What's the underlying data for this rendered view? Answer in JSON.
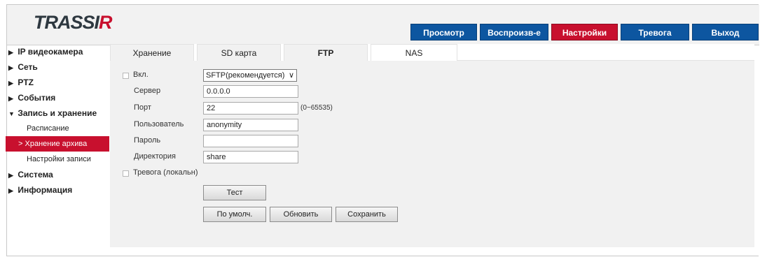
{
  "brand": {
    "logo_main": "TRASSI",
    "logo_accent": "R"
  },
  "topnav": [
    {
      "label": "Просмотр",
      "active": false
    },
    {
      "label": "Воспроизв-е",
      "active": false
    },
    {
      "label": "Настройки",
      "active": true
    },
    {
      "label": "Тревога",
      "active": false
    },
    {
      "label": "Выход",
      "active": false
    }
  ],
  "sidebar": {
    "items": [
      {
        "label": "IP видеокамера",
        "arrow": "▶"
      },
      {
        "label": "Сеть",
        "arrow": "▶"
      },
      {
        "label": "PTZ",
        "arrow": "▶"
      },
      {
        "label": "События",
        "arrow": "▶"
      },
      {
        "label": "Запись и хранение",
        "arrow": "▼"
      },
      {
        "label": "Система",
        "arrow": "▶"
      },
      {
        "label": "Информация",
        "arrow": "▶"
      }
    ],
    "sub": [
      {
        "label": "Расписание"
      },
      {
        "label": "Хранение архива",
        "prefix": ">"
      },
      {
        "label": "Настройки записи"
      }
    ]
  },
  "tabs": [
    {
      "label": "Хранение"
    },
    {
      "label": "SD карта"
    },
    {
      "label": "FTP"
    },
    {
      "label": "NAS"
    }
  ],
  "form": {
    "enable_label": "Вкл.",
    "protocol_value": "SFTP(рекомендуется)",
    "server_label": "Сервер",
    "server_value": "0.0.0.0",
    "port_label": "Порт",
    "port_value": "22",
    "port_hint": "(0~65535)",
    "user_label": "Пользователь",
    "user_value": "anonymity",
    "password_label": "Пароль",
    "password_value": "",
    "dir_label": "Директория",
    "dir_value": "share",
    "alarm_label": "Тревога (локальн)"
  },
  "buttons": {
    "test": "Тест",
    "default": "По умолч.",
    "refresh": "Обновить",
    "save": "Сохранить"
  },
  "colors": {
    "accent": "#c8102e",
    "nav_blue": "#0d56a0"
  }
}
